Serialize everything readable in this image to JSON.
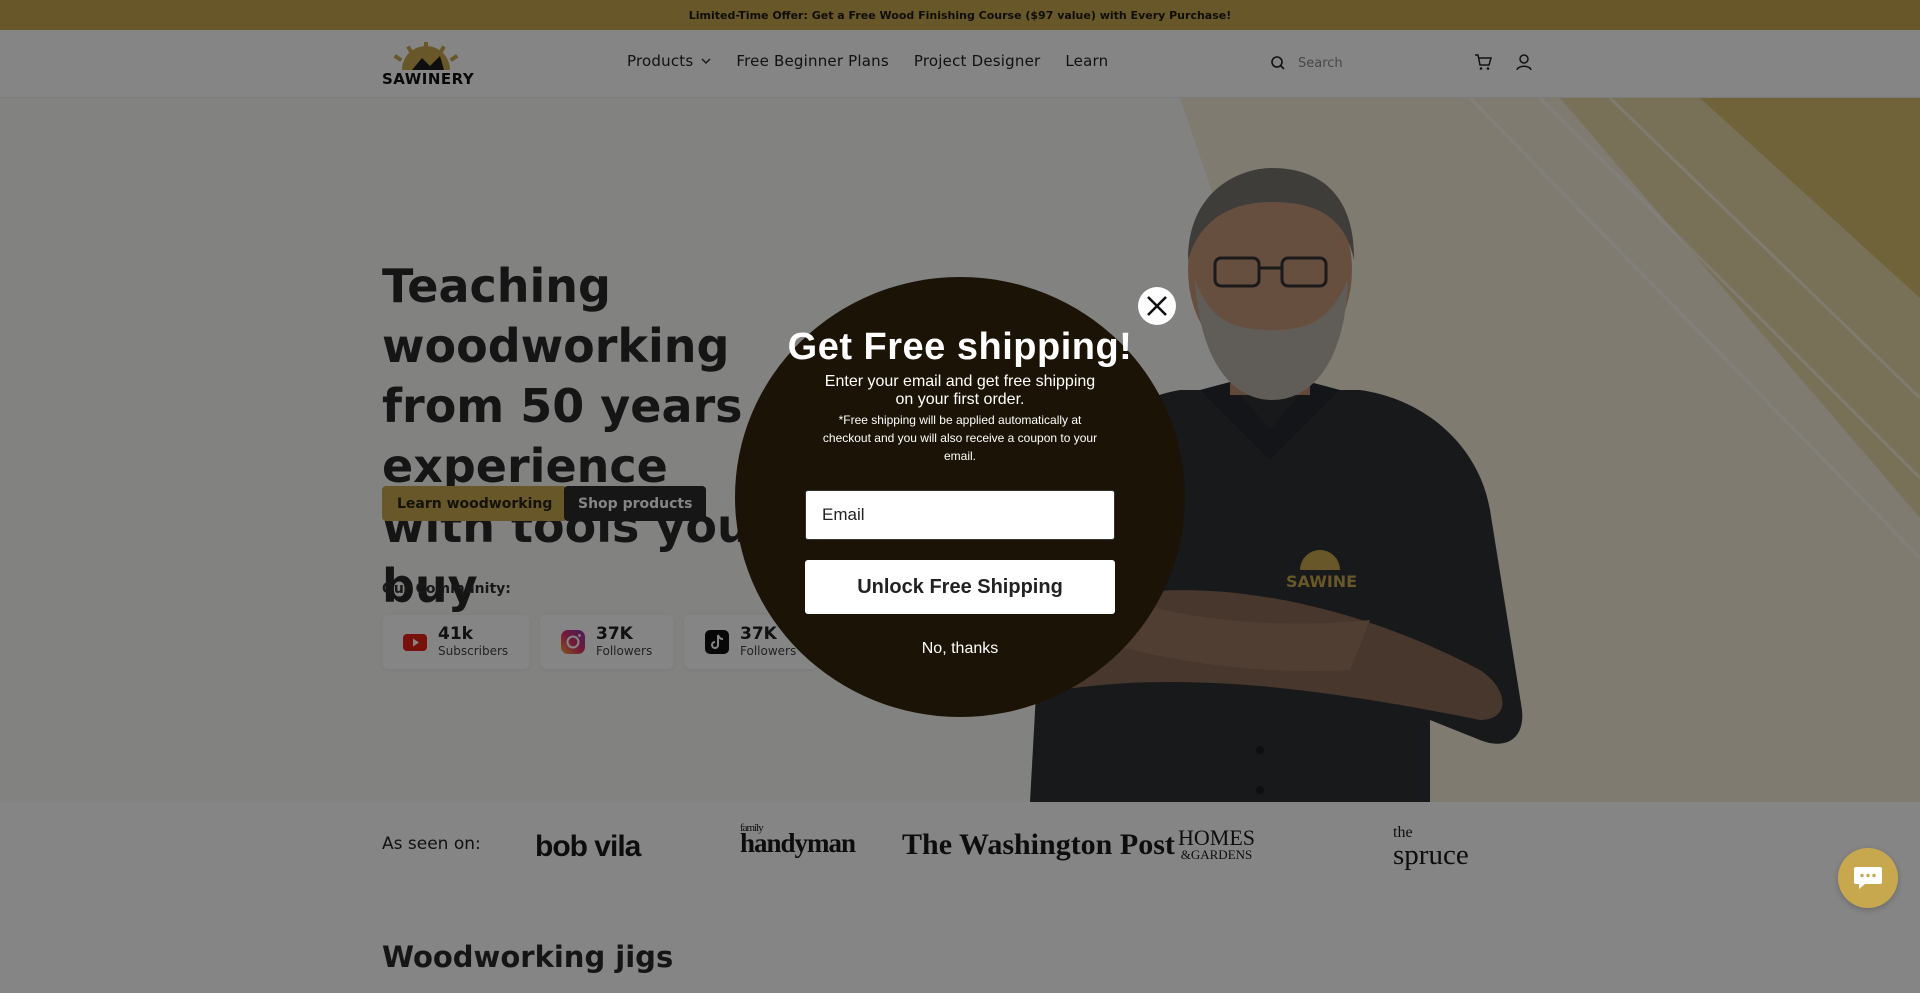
{
  "announcement": "Limited-Time Offer: Get a Free Wood Finishing Course ($97 value) with Every Purchase!",
  "brand": {
    "name": "SAWINERY",
    "accent": "#c8a84f"
  },
  "nav": {
    "items": [
      {
        "label": "Products",
        "has_dropdown": true
      },
      {
        "label": "Free Beginner Plans"
      },
      {
        "label": "Project Designer"
      },
      {
        "label": "Learn"
      }
    ]
  },
  "search": {
    "placeholder": "Search",
    "icon": "search-icon"
  },
  "header_icons": {
    "cart": "cart-icon",
    "account": "account-icon"
  },
  "hero": {
    "title_lines": [
      "Teaching woodworking",
      "from 50 years of experience",
      "with tools you can buy"
    ],
    "learn_button": "Learn woodworking",
    "shop_button": "Shop products",
    "community_label": "Our Community:",
    "stats": [
      {
        "platform": "youtube",
        "icon": "youtube-icon",
        "value": "41k",
        "label": "Subscribers"
      },
      {
        "platform": "instagram",
        "icon": "instagram-icon",
        "value": "37K",
        "label": "Followers"
      },
      {
        "platform": "tiktok",
        "icon": "tiktok-icon",
        "value": "37K",
        "label": "Followers"
      }
    ],
    "shirt_logo_text": "SAWINE"
  },
  "seen_on": {
    "label": "As seen on:",
    "outlets": {
      "bobvila": "bob vila",
      "handyman_small": "family",
      "handyman": "handyman",
      "washington_post": "The Washington Post",
      "homes_line1": "HOMES",
      "homes_line2": "&GARDENS",
      "spruce_small": "the",
      "spruce": "spruce"
    }
  },
  "section_title": "Woodworking jigs",
  "popup": {
    "title": "Get Free shipping!",
    "subtitle": "Enter your email and get free shipping on your first order.",
    "note": "*Free shipping will be applied automatically at checkout and you will also receive a coupon to your email.",
    "email_placeholder": "Email",
    "cta": "Unlock Free Shipping",
    "decline": "No, thanks",
    "background": "#1b1305"
  },
  "chat": {
    "icon": "chat-icon"
  }
}
